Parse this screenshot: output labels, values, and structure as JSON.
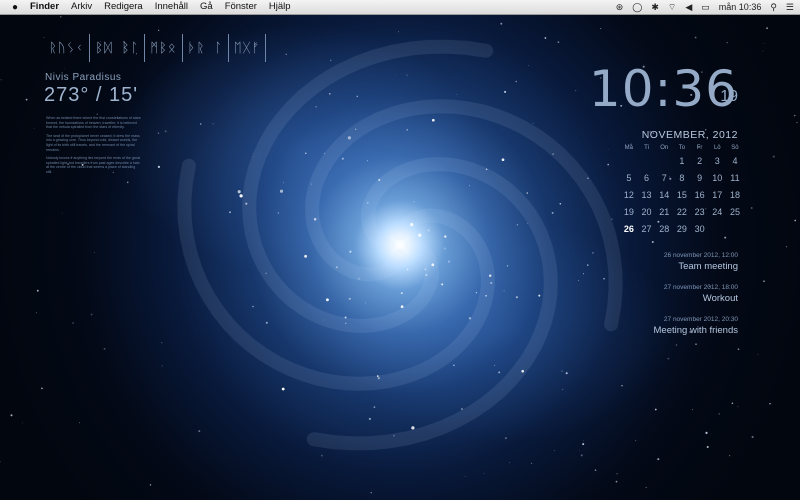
{
  "colors": {
    "accent": "#94aac6",
    "menubar": "#e6e6e6"
  },
  "menubar": {
    "app_name": "Finder",
    "items": [
      "Arkiv",
      "Redigera",
      "Innehåll",
      "Gå",
      "Fönster",
      "Hjälp"
    ],
    "status_icons": [
      "record-icon",
      "chat-icon",
      "bluetooth-icon",
      "wifi-icon",
      "volume-icon",
      "battery-icon"
    ],
    "clock": "mån 10:36"
  },
  "left_widget": {
    "glyphs": [
      "ᚱᚢᛊᚲ",
      "ᛒᛞ ᛒᛚ",
      "ᛗᛒᛟ",
      "ᚦᚱ ᛚ",
      "ᛖᚷᚠ"
    ],
    "place_name": "Nivis Paradisus",
    "coordinates": "273° / 15'",
    "lore": [
      "When as twisted there where the first constellations of stars formed, the foundations of heaven; traveller, it is believed that the nebula spiralled from the stars of eternity.",
      "The seat of the protoplanet never ceased; it drew the mass into a glowing core. Thus beyond cold, distant worlds, the light of its birth still travels, and the remnant of the spiral remains.",
      "Nobody knows if anything lies beyond the ends of the great spiralled light; but travellers from past ages describe a halo at the centre of the cloud that seems a place of standing still."
    ]
  },
  "clock": {
    "time": "10:36",
    "seconds": "19"
  },
  "calendar": {
    "month": "NOVEMBER, 2012",
    "weekdays": [
      "Må",
      "Ti",
      "On",
      "To",
      "Fr",
      "Lö",
      "Sö"
    ],
    "weeks": [
      [
        "",
        "",
        "",
        "1",
        "2",
        "3",
        "4"
      ],
      [
        "5",
        "6",
        "7",
        "8",
        "9",
        "10",
        "11"
      ],
      [
        "12",
        "13",
        "14",
        "15",
        "16",
        "17",
        "18"
      ],
      [
        "19",
        "20",
        "21",
        "22",
        "23",
        "24",
        "25"
      ],
      [
        "26",
        "27",
        "28",
        "29",
        "30",
        "",
        ""
      ]
    ],
    "today": "26"
  },
  "events": [
    {
      "time": "26 november 2012, 12:00",
      "title": "Team meeting"
    },
    {
      "time": "27 november 2012, 18:00",
      "title": "Workout"
    },
    {
      "time": "27 november 2012, 20:30",
      "title": "Meeting with friends"
    }
  ]
}
